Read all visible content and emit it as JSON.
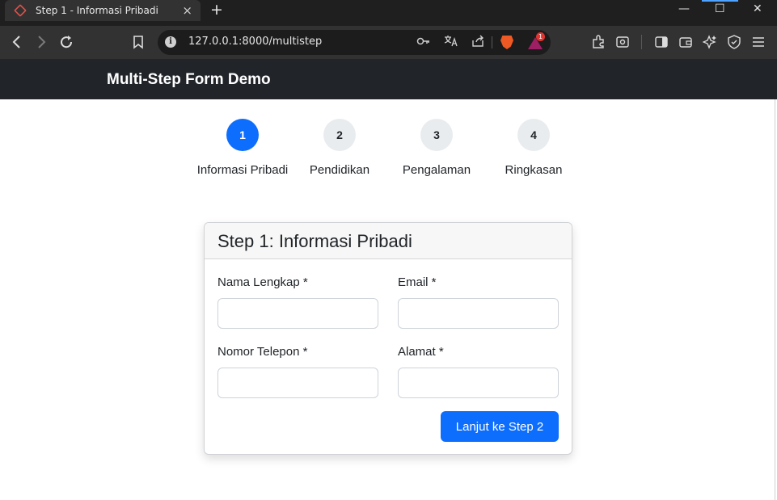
{
  "browser": {
    "tab_title": "Step 1 - Informasi Pribadi",
    "tab_close": "×",
    "new_tab": "+",
    "url": "127.0.0.1:8000/multistep",
    "badge_count": "1",
    "icons": [
      "back-icon",
      "forward-icon",
      "reload-icon",
      "bookmark-icon",
      "site-info-icon",
      "key-icon",
      "translate-icon",
      "share-icon",
      "brave-shields-icon",
      "brave-rewards-icon",
      "extensions-icon",
      "screenshot-icon",
      "sidebar-icon",
      "wallet-icon",
      "leo-ai-icon",
      "vpn-icon",
      "menu-icon"
    ],
    "window_controls": {
      "minimize": "—",
      "maximize": "☐",
      "close": "✕"
    }
  },
  "navbar": {
    "brand": "Multi-Step Form Demo"
  },
  "steps": [
    {
      "number": "1",
      "label": "Informasi Pribadi",
      "active": true
    },
    {
      "number": "2",
      "label": "Pendidikan",
      "active": false
    },
    {
      "number": "3",
      "label": "Pengalaman",
      "active": false
    },
    {
      "number": "4",
      "label": "Ringkasan",
      "active": false
    }
  ],
  "form": {
    "title": "Step 1: Informasi Pribadi",
    "fields": [
      {
        "label": "Nama Lengkap *",
        "value": ""
      },
      {
        "label": "Email *",
        "value": ""
      },
      {
        "label": "Nomor Telepon *",
        "value": ""
      },
      {
        "label": "Alamat *",
        "value": ""
      }
    ],
    "next_button": "Lanjut ke Step 2"
  },
  "colors": {
    "primary": "#0d6efd",
    "navbar": "#212529",
    "step_inactive": "#e9ecef"
  }
}
